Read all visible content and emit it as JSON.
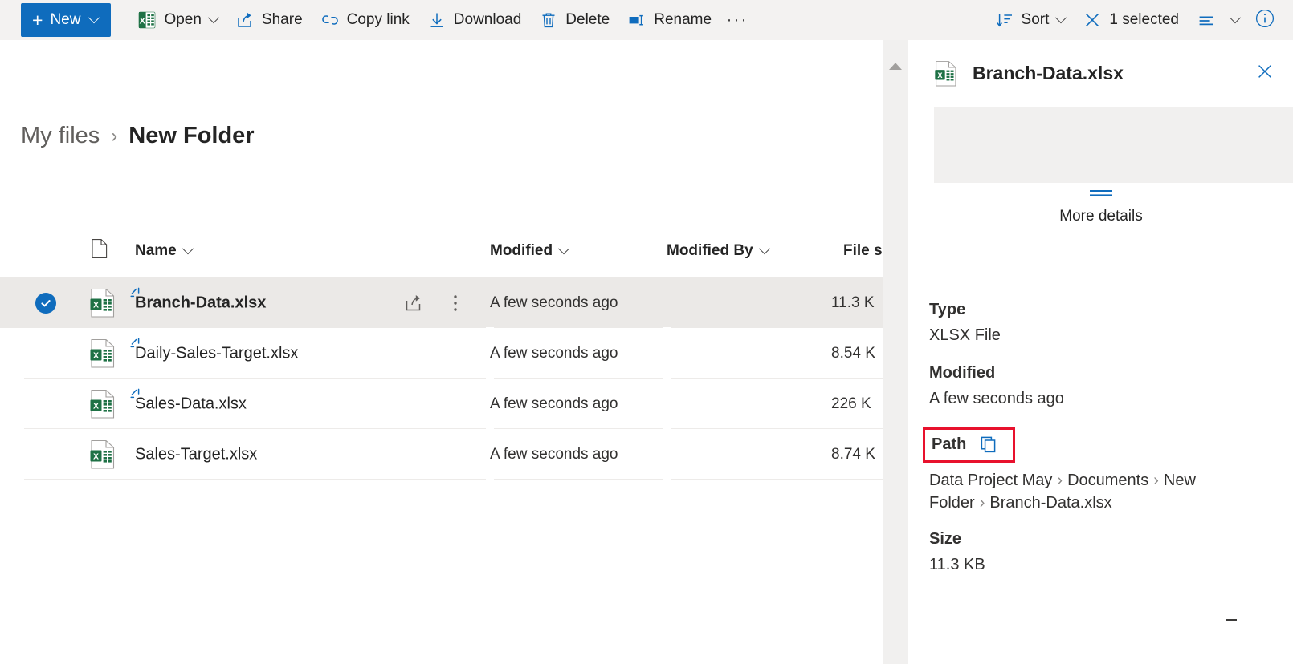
{
  "command_bar": {
    "new_button": {
      "label": "New",
      "icon": "plus-icon",
      "chevron": "chevron-down-icon"
    },
    "items": [
      {
        "key": "open",
        "label": "Open",
        "icon": "excel-icon",
        "has_chevron": true
      },
      {
        "key": "share",
        "label": "Share",
        "icon": "share-icon",
        "has_chevron": false
      },
      {
        "key": "copy-link",
        "label": "Copy link",
        "icon": "link-icon",
        "has_chevron": false
      },
      {
        "key": "download",
        "label": "Download",
        "icon": "download-icon",
        "has_chevron": false
      },
      {
        "key": "delete",
        "label": "Delete",
        "icon": "trash-icon",
        "has_chevron": false
      },
      {
        "key": "rename",
        "label": "Rename",
        "icon": "rename-icon",
        "has_chevron": false
      }
    ],
    "overflow_label": "···",
    "sort": {
      "label": "Sort",
      "icon": "sort-icon",
      "chevron": "chevron-down-icon"
    },
    "selection": {
      "label": "1 selected",
      "icon": "close-x-icon"
    },
    "view": {
      "icon": "list-view-icon",
      "chevron": "chevron-down-icon"
    },
    "info": {
      "icon": "info-circle-icon"
    }
  },
  "breadcrumb": {
    "root": "My files",
    "separator": "›",
    "current": "New Folder"
  },
  "columns": {
    "icon_header": "file-type-icon",
    "name": "Name",
    "modified": "Modified",
    "modified_by": "Modified By",
    "file_size": "File s",
    "chevron": "ˇ"
  },
  "files": [
    {
      "name": "Branch-Data.xlsx",
      "icon": "excel-file-icon",
      "is_new": true,
      "selected": true,
      "modified": "A few seconds ago",
      "modified_by": "",
      "size": "11.3 K",
      "actions": {
        "share": "share-icon",
        "more": "more-vertical-icon"
      }
    },
    {
      "name": "Daily-Sales-Target.xlsx",
      "icon": "excel-file-icon",
      "is_new": true,
      "selected": false,
      "modified": "A few seconds ago",
      "modified_by": "",
      "size": "8.54 K",
      "actions": null
    },
    {
      "name": "Sales-Data.xlsx",
      "icon": "excel-file-icon",
      "is_new": true,
      "selected": false,
      "modified": "A few seconds ago",
      "modified_by": "",
      "size": "226 K",
      "actions": null
    },
    {
      "name": "Sales-Target.xlsx",
      "icon": "excel-file-icon",
      "is_new": false,
      "selected": false,
      "modified": "A few seconds ago",
      "modified_by": "",
      "size": "8.74 K",
      "actions": null
    }
  ],
  "scrollbar": {
    "up_arrow": "scroll-up-arrow-icon"
  },
  "details_panel": {
    "title": "Branch-Data.xlsx",
    "file_icon": "excel-file-icon",
    "close_icon": "close-x-icon",
    "thumbnail": "",
    "more_details": {
      "label": "More details",
      "glyph": "collapse-lines-icon"
    },
    "fields": [
      {
        "key": "type",
        "label": "Type",
        "value": "XLSX File"
      },
      {
        "key": "modified",
        "label": "Modified",
        "value": "A few seconds ago"
      }
    ],
    "path_field": {
      "label": "Path",
      "copy_icon": "copy-icon",
      "highlight_color": "#e8112d",
      "crumbs": [
        "Data Project May",
        "Documents",
        "New Folder",
        "Branch-Data.xlsx"
      ],
      "separator": "›"
    },
    "size_field": {
      "label": "Size",
      "value": "11.3 KB"
    }
  },
  "colors": {
    "accent": "#0f6cbd",
    "command_bar_bg": "#f3f2f1",
    "selected_row_bg": "#ebe9e7",
    "excel_green": "#1e7145",
    "highlight_red": "#e8112d"
  }
}
